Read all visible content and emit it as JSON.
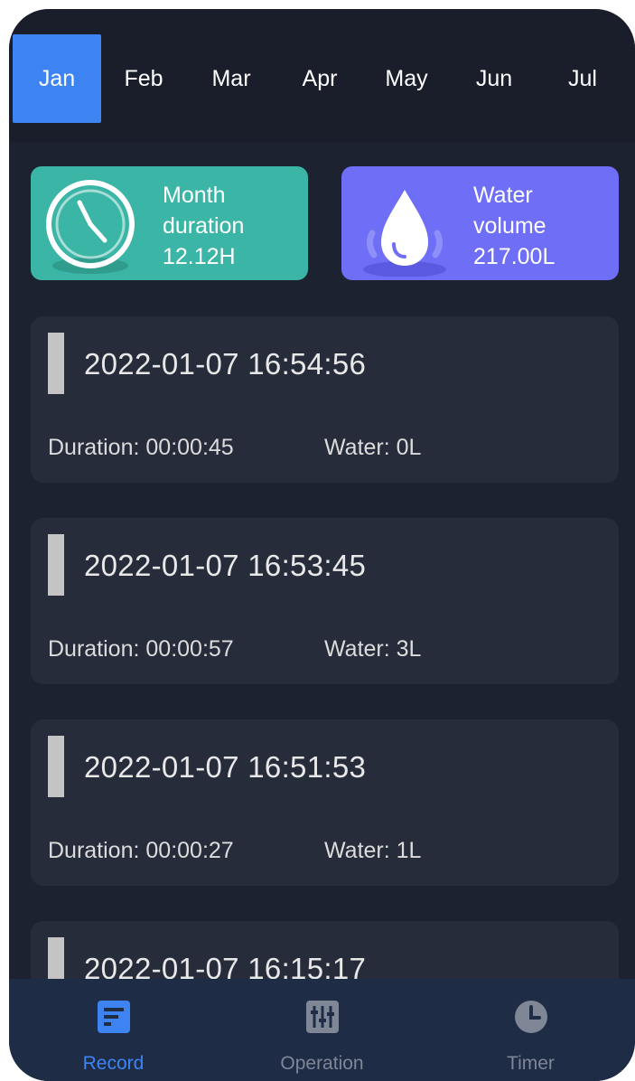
{
  "months": [
    {
      "label": "Jan",
      "active": true
    },
    {
      "label": "Feb",
      "active": false
    },
    {
      "label": "Mar",
      "active": false
    },
    {
      "label": "Apr",
      "active": false
    },
    {
      "label": "May",
      "active": false
    },
    {
      "label": "Jun",
      "active": false
    },
    {
      "label": "Jul",
      "active": false
    }
  ],
  "summary": {
    "duration": {
      "line1": "Month",
      "line2": "duration",
      "value": "12.12H",
      "icon": "clock-icon"
    },
    "water": {
      "line1": "Water",
      "line2": "volume",
      "value": "217.00L",
      "icon": "water-drop-icon"
    }
  },
  "records": [
    {
      "datetime": "2022-01-07 16:54:56",
      "duration": "Duration: 00:00:45",
      "water": "Water: 0L"
    },
    {
      "datetime": "2022-01-07 16:53:45",
      "duration": "Duration: 00:00:57",
      "water": "Water: 3L"
    },
    {
      "datetime": "2022-01-07 16:51:53",
      "duration": "Duration: 00:00:27",
      "water": "Water: 1L"
    },
    {
      "datetime": "2022-01-07 16:15:17",
      "duration": "",
      "water": ""
    }
  ],
  "nav": {
    "record": {
      "label": "Record",
      "icon": "record-icon"
    },
    "operation": {
      "label": "Operation",
      "icon": "operation-icon"
    },
    "timer": {
      "label": "Timer",
      "icon": "timer-icon"
    }
  },
  "colors": {
    "accent": "#3d84f2",
    "background": "#1d2231",
    "card_duration": "#3bb5a5",
    "card_water": "#6e6ef7"
  }
}
